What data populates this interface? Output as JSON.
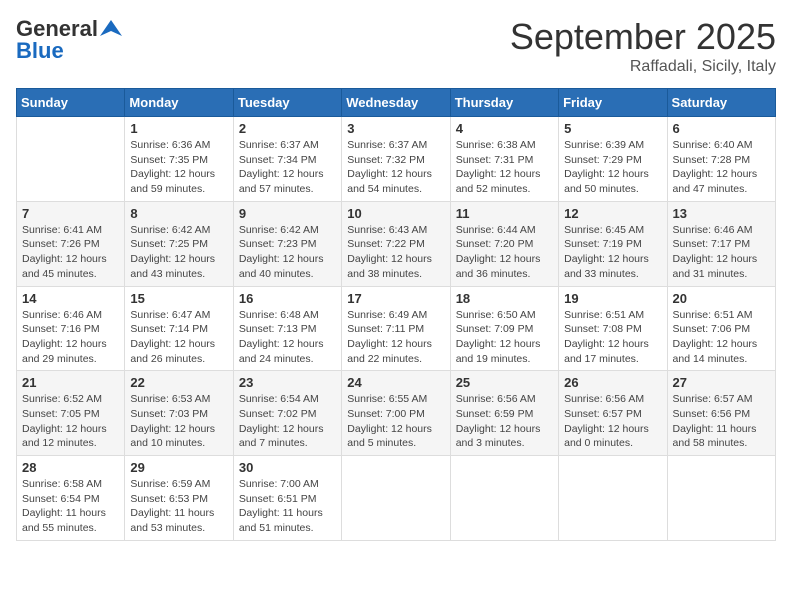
{
  "logo": {
    "general": "General",
    "blue": "Blue"
  },
  "header": {
    "month": "September 2025",
    "location": "Raffadali, Sicily, Italy"
  },
  "weekdays": [
    "Sunday",
    "Monday",
    "Tuesday",
    "Wednesday",
    "Thursday",
    "Friday",
    "Saturday"
  ],
  "weeks": [
    [
      {
        "day": "",
        "sunrise": "",
        "sunset": "",
        "daylight": ""
      },
      {
        "day": "1",
        "sunrise": "Sunrise: 6:36 AM",
        "sunset": "Sunset: 7:35 PM",
        "daylight": "Daylight: 12 hours and 59 minutes."
      },
      {
        "day": "2",
        "sunrise": "Sunrise: 6:37 AM",
        "sunset": "Sunset: 7:34 PM",
        "daylight": "Daylight: 12 hours and 57 minutes."
      },
      {
        "day": "3",
        "sunrise": "Sunrise: 6:37 AM",
        "sunset": "Sunset: 7:32 PM",
        "daylight": "Daylight: 12 hours and 54 minutes."
      },
      {
        "day": "4",
        "sunrise": "Sunrise: 6:38 AM",
        "sunset": "Sunset: 7:31 PM",
        "daylight": "Daylight: 12 hours and 52 minutes."
      },
      {
        "day": "5",
        "sunrise": "Sunrise: 6:39 AM",
        "sunset": "Sunset: 7:29 PM",
        "daylight": "Daylight: 12 hours and 50 minutes."
      },
      {
        "day": "6",
        "sunrise": "Sunrise: 6:40 AM",
        "sunset": "Sunset: 7:28 PM",
        "daylight": "Daylight: 12 hours and 47 minutes."
      }
    ],
    [
      {
        "day": "7",
        "sunrise": "Sunrise: 6:41 AM",
        "sunset": "Sunset: 7:26 PM",
        "daylight": "Daylight: 12 hours and 45 minutes."
      },
      {
        "day": "8",
        "sunrise": "Sunrise: 6:42 AM",
        "sunset": "Sunset: 7:25 PM",
        "daylight": "Daylight: 12 hours and 43 minutes."
      },
      {
        "day": "9",
        "sunrise": "Sunrise: 6:42 AM",
        "sunset": "Sunset: 7:23 PM",
        "daylight": "Daylight: 12 hours and 40 minutes."
      },
      {
        "day": "10",
        "sunrise": "Sunrise: 6:43 AM",
        "sunset": "Sunset: 7:22 PM",
        "daylight": "Daylight: 12 hours and 38 minutes."
      },
      {
        "day": "11",
        "sunrise": "Sunrise: 6:44 AM",
        "sunset": "Sunset: 7:20 PM",
        "daylight": "Daylight: 12 hours and 36 minutes."
      },
      {
        "day": "12",
        "sunrise": "Sunrise: 6:45 AM",
        "sunset": "Sunset: 7:19 PM",
        "daylight": "Daylight: 12 hours and 33 minutes."
      },
      {
        "day": "13",
        "sunrise": "Sunrise: 6:46 AM",
        "sunset": "Sunset: 7:17 PM",
        "daylight": "Daylight: 12 hours and 31 minutes."
      }
    ],
    [
      {
        "day": "14",
        "sunrise": "Sunrise: 6:46 AM",
        "sunset": "Sunset: 7:16 PM",
        "daylight": "Daylight: 12 hours and 29 minutes."
      },
      {
        "day": "15",
        "sunrise": "Sunrise: 6:47 AM",
        "sunset": "Sunset: 7:14 PM",
        "daylight": "Daylight: 12 hours and 26 minutes."
      },
      {
        "day": "16",
        "sunrise": "Sunrise: 6:48 AM",
        "sunset": "Sunset: 7:13 PM",
        "daylight": "Daylight: 12 hours and 24 minutes."
      },
      {
        "day": "17",
        "sunrise": "Sunrise: 6:49 AM",
        "sunset": "Sunset: 7:11 PM",
        "daylight": "Daylight: 12 hours and 22 minutes."
      },
      {
        "day": "18",
        "sunrise": "Sunrise: 6:50 AM",
        "sunset": "Sunset: 7:09 PM",
        "daylight": "Daylight: 12 hours and 19 minutes."
      },
      {
        "day": "19",
        "sunrise": "Sunrise: 6:51 AM",
        "sunset": "Sunset: 7:08 PM",
        "daylight": "Daylight: 12 hours and 17 minutes."
      },
      {
        "day": "20",
        "sunrise": "Sunrise: 6:51 AM",
        "sunset": "Sunset: 7:06 PM",
        "daylight": "Daylight: 12 hours and 14 minutes."
      }
    ],
    [
      {
        "day": "21",
        "sunrise": "Sunrise: 6:52 AM",
        "sunset": "Sunset: 7:05 PM",
        "daylight": "Daylight: 12 hours and 12 minutes."
      },
      {
        "day": "22",
        "sunrise": "Sunrise: 6:53 AM",
        "sunset": "Sunset: 7:03 PM",
        "daylight": "Daylight: 12 hours and 10 minutes."
      },
      {
        "day": "23",
        "sunrise": "Sunrise: 6:54 AM",
        "sunset": "Sunset: 7:02 PM",
        "daylight": "Daylight: 12 hours and 7 minutes."
      },
      {
        "day": "24",
        "sunrise": "Sunrise: 6:55 AM",
        "sunset": "Sunset: 7:00 PM",
        "daylight": "Daylight: 12 hours and 5 minutes."
      },
      {
        "day": "25",
        "sunrise": "Sunrise: 6:56 AM",
        "sunset": "Sunset: 6:59 PM",
        "daylight": "Daylight: 12 hours and 3 minutes."
      },
      {
        "day": "26",
        "sunrise": "Sunrise: 6:56 AM",
        "sunset": "Sunset: 6:57 PM",
        "daylight": "Daylight: 12 hours and 0 minutes."
      },
      {
        "day": "27",
        "sunrise": "Sunrise: 6:57 AM",
        "sunset": "Sunset: 6:56 PM",
        "daylight": "Daylight: 11 hours and 58 minutes."
      }
    ],
    [
      {
        "day": "28",
        "sunrise": "Sunrise: 6:58 AM",
        "sunset": "Sunset: 6:54 PM",
        "daylight": "Daylight: 11 hours and 55 minutes."
      },
      {
        "day": "29",
        "sunrise": "Sunrise: 6:59 AM",
        "sunset": "Sunset: 6:53 PM",
        "daylight": "Daylight: 11 hours and 53 minutes."
      },
      {
        "day": "30",
        "sunrise": "Sunrise: 7:00 AM",
        "sunset": "Sunset: 6:51 PM",
        "daylight": "Daylight: 11 hours and 51 minutes."
      },
      {
        "day": "",
        "sunrise": "",
        "sunset": "",
        "daylight": ""
      },
      {
        "day": "",
        "sunrise": "",
        "sunset": "",
        "daylight": ""
      },
      {
        "day": "",
        "sunrise": "",
        "sunset": "",
        "daylight": ""
      },
      {
        "day": "",
        "sunrise": "",
        "sunset": "",
        "daylight": ""
      }
    ]
  ]
}
